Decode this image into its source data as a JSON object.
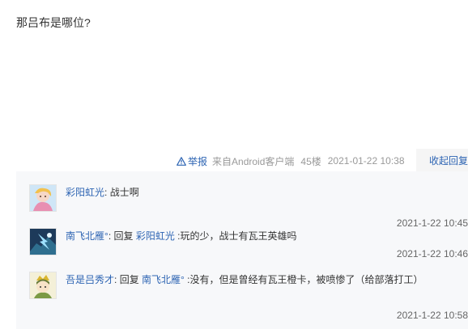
{
  "post": {
    "content": "那吕布是哪位?"
  },
  "tail": {
    "report_label": "举报",
    "source": "来自Android客户端",
    "floor": "45楼",
    "date": "2021-01-22 10:38",
    "collapse_label": "收起回复"
  },
  "replies": [
    {
      "username": "彩阳虹光",
      "separator": ":",
      "text": " 战士啊",
      "time": "2021-1-22 10:45"
    },
    {
      "username": "南飞北雁°",
      "separator": ":",
      "reply_word": " 回复 ",
      "target": "彩阳虹光",
      "text": " :玩的少，战士有瓦王英雄吗",
      "time": "2021-1-22 10:46"
    },
    {
      "username": "吾是吕秀才",
      "separator": ":",
      "reply_word": " 回复 ",
      "target": "南飞北雁°",
      "text": " :没有，但是曾经有瓦王橙卡，被喷惨了（给部落打工）",
      "time": "2021-1-22 10:58"
    }
  ],
  "colors": {
    "link": "#2d64b3",
    "reply_bg": "#f7f8fa"
  },
  "icons": {
    "report": "warning-triangle-icon"
  }
}
